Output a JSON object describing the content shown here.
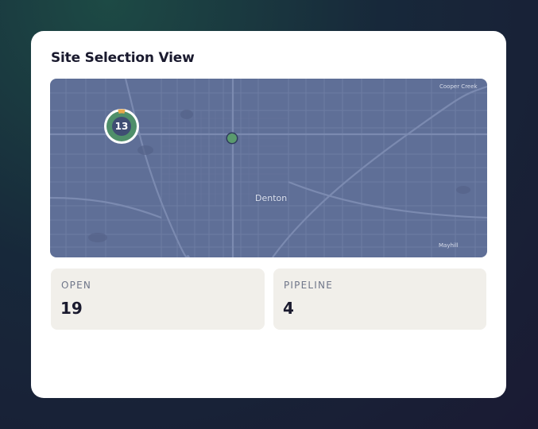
{
  "card": {
    "title": "Site Selection View"
  },
  "map": {
    "labels": {
      "city": "Denton",
      "north_east": "Cooper Creek",
      "south_east": "Mayhill"
    },
    "cluster": {
      "count": "13",
      "color": "#4f8f6a",
      "accent": "#e8a84a"
    },
    "marker_color": "#5a9a6e"
  },
  "stats": {
    "open": {
      "label": "OPEN",
      "value": "19"
    },
    "pipeline": {
      "label": "PIPELINE",
      "value": "4"
    }
  }
}
